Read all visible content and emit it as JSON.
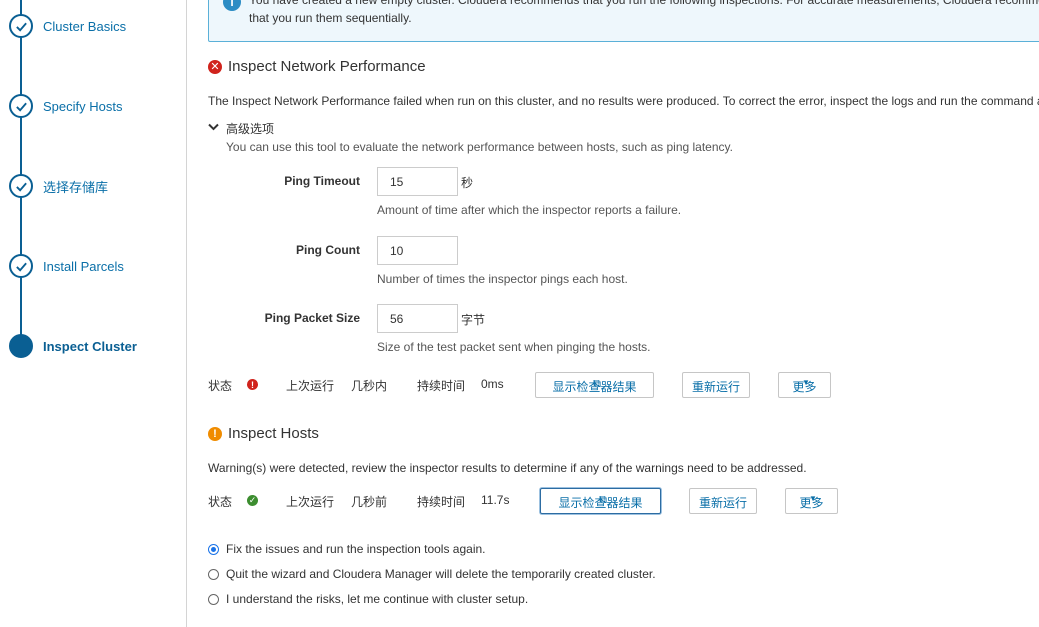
{
  "sidebar": {
    "steps": [
      {
        "label": "Cluster Basics",
        "state": "done"
      },
      {
        "label": "Specify Hosts",
        "state": "done"
      },
      {
        "label": "选择存储库",
        "state": "done"
      },
      {
        "label": "Install Parcels",
        "state": "done"
      },
      {
        "label": "Inspect Cluster",
        "state": "active"
      }
    ]
  },
  "info": {
    "text": "You have created a new empty cluster. Cloudera recommends that you run the following inspections. For accurate measurements, Cloudera recommends that you run them sequentially."
  },
  "network": {
    "title": "Inspect Network Performance",
    "description": "The Inspect Network Performance failed when run on this cluster, and no results were produced. To correct the error, inspect the logs and run the command again.",
    "advanced_label": "高级选项",
    "advanced_desc": "You can use this tool to evaluate the network performance between hosts, such as ping latency.",
    "fields": {
      "timeout": {
        "label": "Ping Timeout",
        "value": "15",
        "unit": "秒",
        "help": "Amount of time after which the inspector reports a failure."
      },
      "count": {
        "label": "Ping Count",
        "value": "10",
        "unit": "",
        "help": "Number of times the inspector pings each host."
      },
      "size": {
        "label": "Ping Packet Size",
        "value": "56",
        "unit": "字节",
        "help": "Size of the test packet sent when pinging the hosts."
      }
    },
    "status": {
      "status_label": "状态",
      "last_run_label": "上次运行",
      "last_run_value": "几秒内",
      "duration_label": "持续时间",
      "duration_value": "0ms",
      "show_results": "显示检查器结果",
      "rerun": "重新运行",
      "more": "更多"
    }
  },
  "hosts": {
    "title": "Inspect Hosts",
    "description": "Warning(s) were detected, review the inspector results to determine if any of the warnings need to be addressed.",
    "status": {
      "status_label": "状态",
      "last_run_label": "上次运行",
      "last_run_value": "几秒前",
      "duration_label": "持续时间",
      "duration_value": "11.7s",
      "show_results": "显示检查器结果",
      "rerun": "重新运行",
      "more": "更多"
    }
  },
  "options": [
    {
      "label": "Fix the issues and run the inspection tools again.",
      "checked": true
    },
    {
      "label": "Quit the wizard and Cloudera Manager will delete the temporarily created cluster.",
      "checked": false
    },
    {
      "label": "I understand the risks, let me continue with cluster setup.",
      "checked": false
    }
  ],
  "colors": {
    "accent": "#0a5f93",
    "error": "#d0231c",
    "warning": "#f08c00",
    "success": "#3c8d2f"
  }
}
